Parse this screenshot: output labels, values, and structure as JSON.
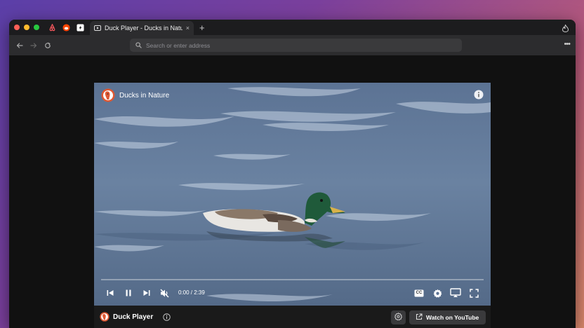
{
  "browser": {
    "tab": {
      "title": "Duck Player - Ducks in Nature",
      "close": "×"
    },
    "new_tab": "+",
    "address_placeholder": "Search or enter address",
    "more": "•••"
  },
  "player": {
    "video_title": "Ducks in Nature",
    "time": "0:00 / 2:39",
    "progress_fraction": 0,
    "cc_label": "CC",
    "footer": {
      "brand": "Duck Player",
      "watch_youtube": "Watch on YouTube"
    }
  },
  "colors": {
    "traffic_red": "#ff5f57",
    "traffic_yellow": "#febc2e",
    "traffic_green": "#28c840",
    "ddg_orange": "#de5833"
  }
}
